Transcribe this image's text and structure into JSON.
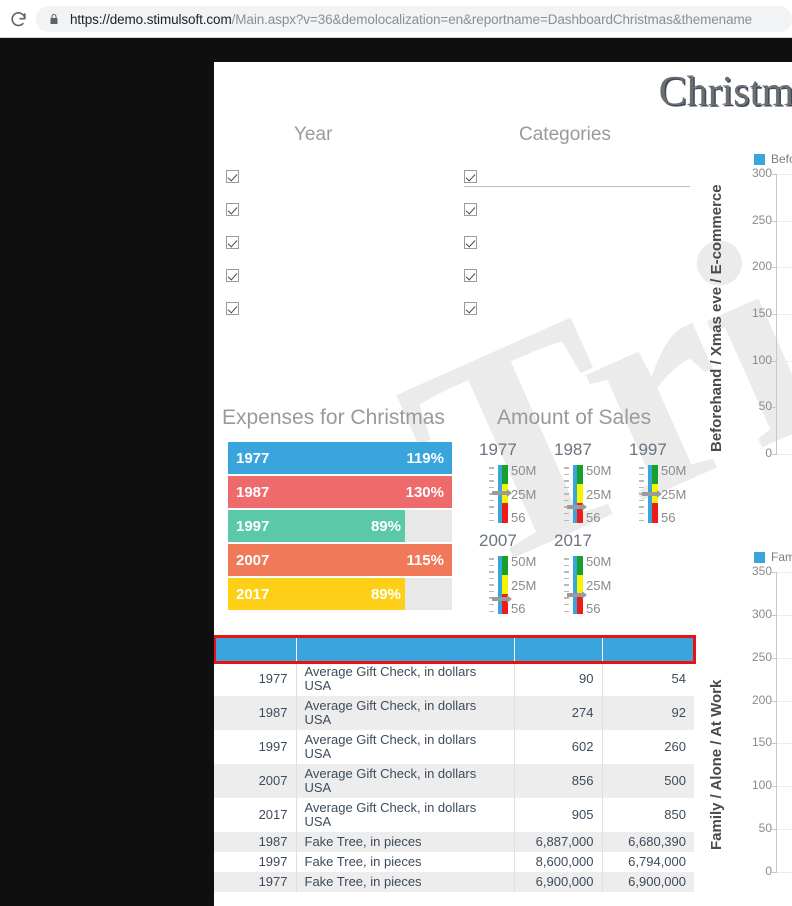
{
  "browser": {
    "reload_icon": "reload-icon",
    "lock_icon": "lock-icon",
    "url_host": "https://demo.stimulsoft.com",
    "url_path": "/Main.aspx?v=36&demolocalization=en&reportname=DashboardChristmas&themename"
  },
  "dashboard": {
    "title": "Christm",
    "watermark_text": "Tri",
    "colors": {
      "accent_blue": "#3aa5dc",
      "selection_red": "#ee1111",
      "panel_title": "#9a9a9a",
      "row_alt": "#ededed",
      "page_bg": "#0f0f0f"
    }
  },
  "filters": {
    "year": {
      "title": "Year",
      "items": [
        {
          "label": "",
          "checked": true
        },
        {
          "label": "",
          "checked": true
        },
        {
          "label": "",
          "checked": true
        },
        {
          "label": "",
          "checked": true
        },
        {
          "label": "",
          "checked": true
        }
      ]
    },
    "categories": {
      "title": "Categories",
      "items": [
        {
          "label": "",
          "checked": true
        },
        {
          "label": "",
          "checked": true
        },
        {
          "label": "",
          "checked": true
        },
        {
          "label": "",
          "checked": true
        },
        {
          "label": "",
          "checked": true
        }
      ]
    }
  },
  "expenses": {
    "title": "Expenses for Christmas",
    "bars": [
      {
        "year": "1977",
        "value": 119,
        "label": "119%",
        "fill": 100,
        "color": "#3aa5dc"
      },
      {
        "year": "1987",
        "value": 130,
        "label": "130%",
        "fill": 100,
        "color": "#ef6b6b"
      },
      {
        "year": "1997",
        "value": 89,
        "label": "89%",
        "fill": 79,
        "color": "#5bc8a8"
      },
      {
        "year": "2007",
        "value": 115,
        "label": "115%",
        "fill": 100,
        "color": "#f0795a"
      },
      {
        "year": "2017",
        "value": 89,
        "label": "89%",
        "fill": 79,
        "color": "#fdd017"
      }
    ]
  },
  "sales": {
    "title": "Amount of Sales",
    "scale": [
      "50M",
      "25M",
      "56"
    ],
    "gauges": [
      {
        "year": "1977",
        "needle_pct": 52
      },
      {
        "year": "1987",
        "needle_pct": 28
      },
      {
        "year": "1997",
        "needle_pct": 50
      },
      {
        "year": "2007",
        "needle_pct": 26
      },
      {
        "year": "2017",
        "needle_pct": 32
      }
    ]
  },
  "table": {
    "headers": [
      "",
      "",
      "",
      ""
    ],
    "rows": [
      {
        "year": "1977",
        "name": "Average Gift Check, in dollars USA",
        "v1": "90",
        "v2": "54"
      },
      {
        "year": "1987",
        "name": "Average Gift Check, in dollars USA",
        "v1": "274",
        "v2": "92"
      },
      {
        "year": "1997",
        "name": "Average Gift Check, in dollars USA",
        "v1": "602",
        "v2": "260"
      },
      {
        "year": "2007",
        "name": "Average Gift Check, in dollars USA",
        "v1": "856",
        "v2": "500"
      },
      {
        "year": "2017",
        "name": "Average Gift Check, in dollars USA",
        "v1": "905",
        "v2": "850"
      },
      {
        "year": "1987",
        "name": "Fake Tree, in pieces",
        "v1": "6,887,000",
        "v2": "6,680,390"
      },
      {
        "year": "1997",
        "name": "Fake Tree, in pieces",
        "v1": "8,600,000",
        "v2": "6,794,000"
      },
      {
        "year": "1977",
        "name": "Fake Tree, in pieces",
        "v1": "6,900,000",
        "v2": "6,900,000"
      }
    ]
  },
  "chart_data": [
    {
      "type": "bar",
      "title": "",
      "id": "chart-top",
      "ylabel": "Beforehand / Xmas eve / E-commerce",
      "xlabel": "",
      "ylim": [
        0,
        300
      ],
      "yticks": [
        300,
        250,
        200,
        150,
        100,
        50,
        0
      ],
      "grid": true,
      "legend_position": "top",
      "legend": [
        "Befo"
      ],
      "series": [
        {
          "name": "Befo",
          "color": "#3aa5dc",
          "values": []
        }
      ],
      "categories": []
    },
    {
      "type": "bar",
      "title": "",
      "id": "chart-bottom",
      "ylabel": "Family / Alone / At Work",
      "xlabel": "",
      "ylim": [
        0,
        350
      ],
      "yticks": [
        350,
        300,
        250,
        200,
        150,
        100,
        50,
        0
      ],
      "grid": true,
      "legend_position": "top",
      "legend": [
        "Fam"
      ],
      "series": [
        {
          "name": "Fam",
          "color": "#3aa5dc",
          "values": []
        }
      ],
      "categories": []
    }
  ]
}
